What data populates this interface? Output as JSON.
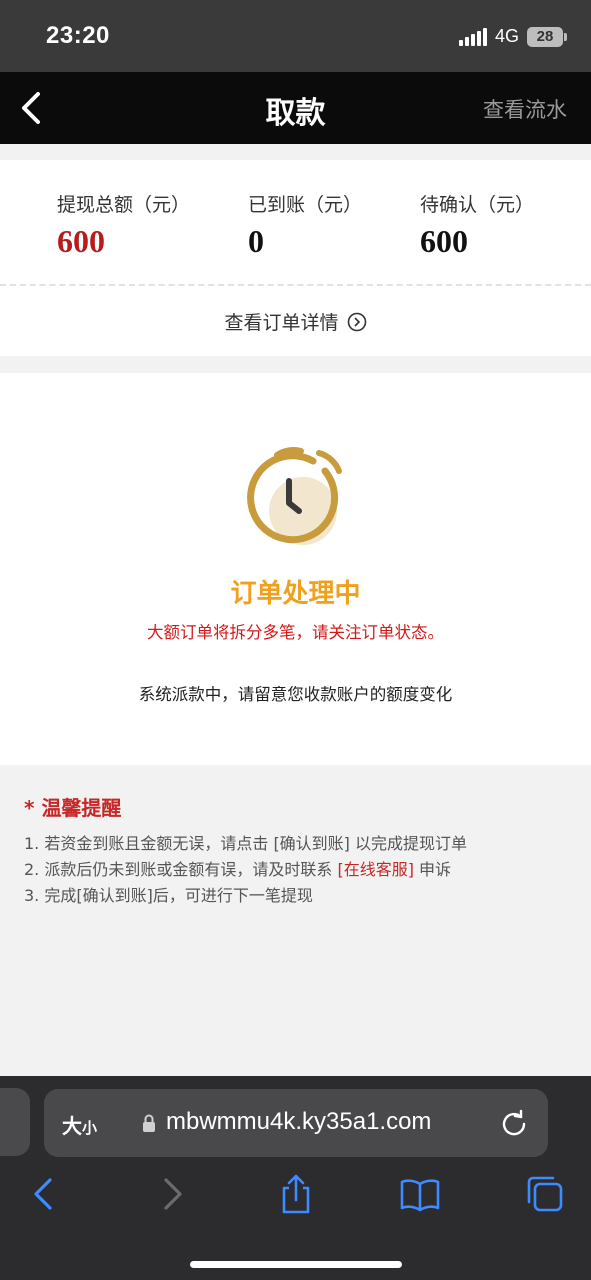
{
  "status_bar": {
    "time": "23:20",
    "network": "4G",
    "battery": "28"
  },
  "nav": {
    "title": "取款",
    "right_link": "查看流水"
  },
  "summary": {
    "columns": [
      {
        "label": "提现总额（元）",
        "value": "600"
      },
      {
        "label": "已到账（元）",
        "value": "0"
      },
      {
        "label": "待确认（元）",
        "value": "600"
      }
    ],
    "detail_link": "查看订单详情"
  },
  "order_status": {
    "title": "订单处理中",
    "warning": "大额订单将拆分多笔，请关注订单状态。",
    "note": "系统派款中，请留意您收款账户的额度变化"
  },
  "tips": {
    "star": "*",
    "title": "温馨提醒",
    "items": [
      "1. 若资金到账且金额无误，请点击 [确认到账] 以完成提现订单",
      "2. 派款后仍未到账或金额有误，请及时联系",
      "3. 完成[确认到账]后，可进行下一笔提现"
    ],
    "service_link": "[在线客服]",
    "appeal": "申诉"
  },
  "browser": {
    "text_size_big": "大",
    "text_size_small": "小",
    "url": "mbwmmu4k.ky35a1.com"
  },
  "colors": {
    "accent_red": "#b71c1c",
    "accent_orange": "#f0a11c",
    "clock_gold": "#c89b3c"
  }
}
